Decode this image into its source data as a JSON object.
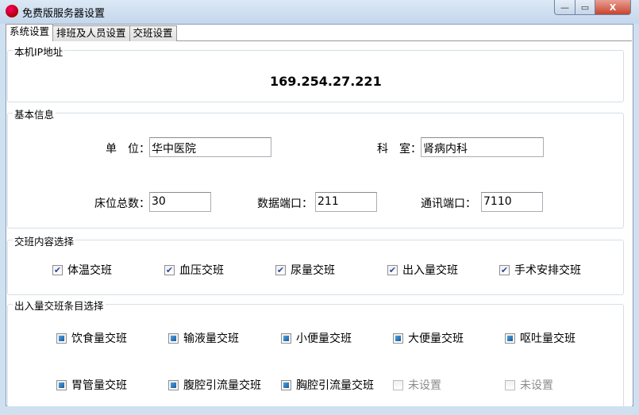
{
  "window": {
    "title": "免费版服务器设置",
    "minimize": "—",
    "maximize": "▭",
    "close": "X"
  },
  "tabs": [
    {
      "label": "系统设置"
    },
    {
      "label": "排班及人员设置"
    },
    {
      "label": "交班设置"
    }
  ],
  "ip_group": {
    "label": "本机IP地址",
    "ip": "169.254.27.221"
  },
  "basic": {
    "label": "基本信息",
    "unit_label": "单　位：",
    "unit": "华中医院",
    "dept_label": "科　室：",
    "dept": "肾病内科",
    "beds_label": "床位总数：",
    "beds": "30",
    "data_port_label": "数据端口：",
    "data_port": "211",
    "comm_port_label": "通讯端口：",
    "comm_port": "7110"
  },
  "content": {
    "label": "交班内容选择",
    "items": [
      {
        "label": "体温交班",
        "checked": true
      },
      {
        "label": "血压交班",
        "checked": true
      },
      {
        "label": "尿量交班",
        "checked": true
      },
      {
        "label": "出入量交班",
        "checked": true
      },
      {
        "label": "手术安排交班",
        "checked": true
      }
    ]
  },
  "io": {
    "label": "出入量交班条目选择",
    "items": [
      {
        "label": "饮食量交班",
        "state": "indeterminate"
      },
      {
        "label": "输液量交班",
        "state": "indeterminate"
      },
      {
        "label": "小便量交班",
        "state": "indeterminate"
      },
      {
        "label": "大便量交班",
        "state": "indeterminate"
      },
      {
        "label": "呕吐量交班",
        "state": "indeterminate"
      },
      {
        "label": "胃管量交班",
        "state": "indeterminate"
      },
      {
        "label": "腹腔引流量交班",
        "state": "indeterminate"
      },
      {
        "label": "胸腔引流量交班",
        "state": "indeterminate"
      },
      {
        "label": "未设置",
        "state": "disabled"
      },
      {
        "label": "未设置",
        "state": "disabled"
      }
    ]
  }
}
